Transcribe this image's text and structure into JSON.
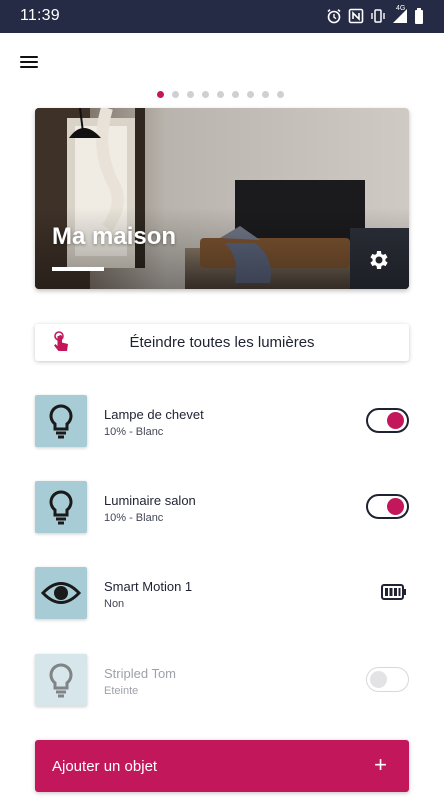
{
  "status_bar": {
    "time": "11:39",
    "network": "4G",
    "icons": [
      "alarm-icon",
      "nfc-icon",
      "vibrate-icon",
      "signal-icon",
      "battery-icon"
    ]
  },
  "pager": {
    "count": 9,
    "active": 0
  },
  "hero": {
    "title": "Ma maison"
  },
  "switch_all": {
    "label": "Éteindre toutes les lumières"
  },
  "devices": [
    {
      "name": "Lampe de chevet",
      "detail": "10% -  Blanc",
      "icon": "bulb-icon",
      "toggle": "on"
    },
    {
      "name": "Luminaire salon",
      "detail": "10% -  Blanc",
      "icon": "bulb-icon",
      "toggle": "on"
    },
    {
      "name": "Smart Motion 1",
      "detail": "Non",
      "icon": "eye-icon",
      "battery": "full"
    },
    {
      "name": "Stripled Tom",
      "detail": "Eteinte",
      "icon": "bulb-icon",
      "toggle": "disabled"
    }
  ],
  "add_button": {
    "label": "Ajouter un objet",
    "plus": "+"
  },
  "colors": {
    "accent": "#c2185b",
    "status_bar": "#262b45",
    "tile": "#a8ccd6",
    "tile_disabled": "#d7e6ea"
  }
}
